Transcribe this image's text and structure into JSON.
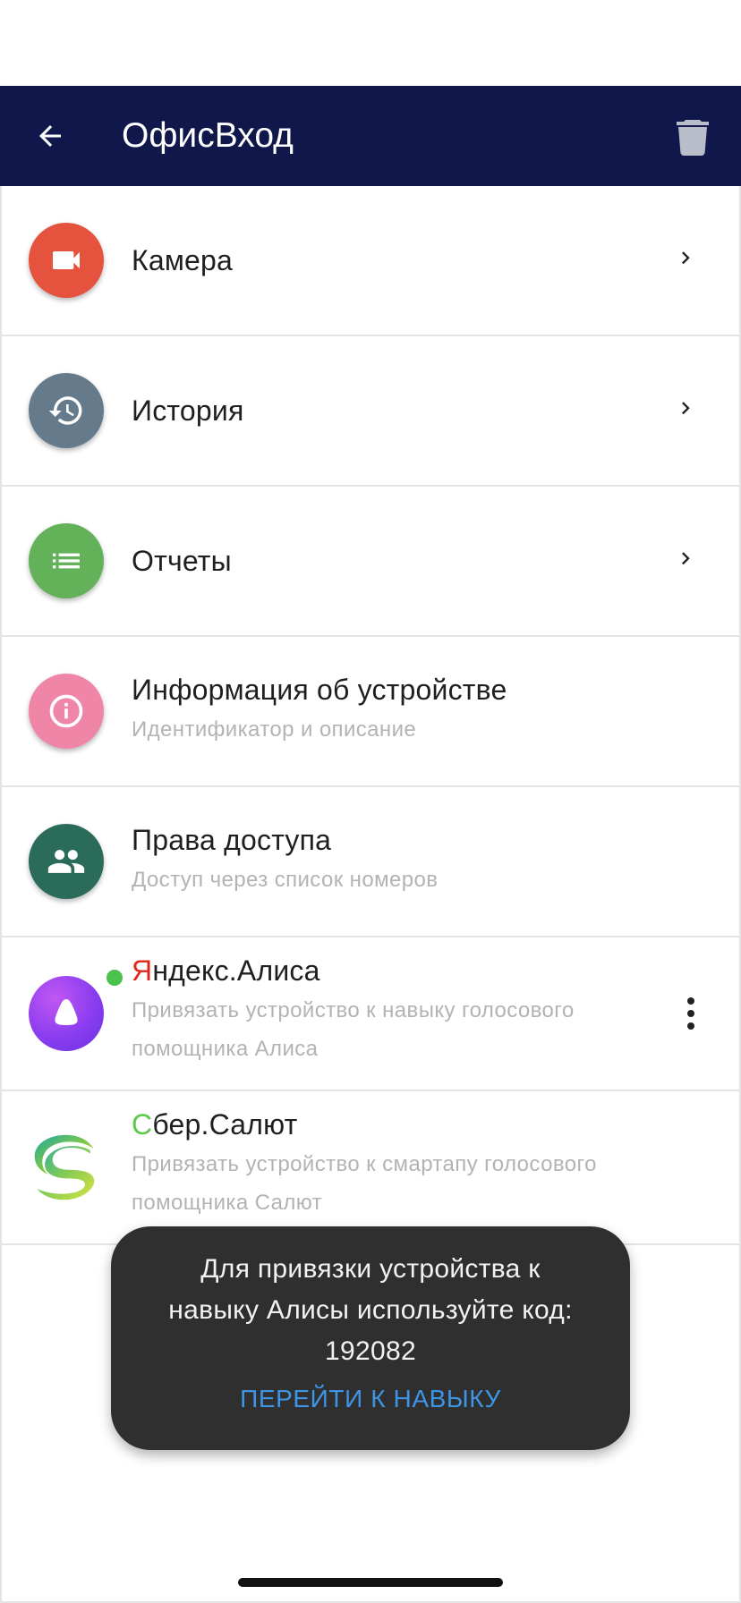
{
  "appbar": {
    "title": "ОфисВход",
    "back_icon": "arrow-back-icon",
    "delete_icon": "trash-icon",
    "background": "#0f174b"
  },
  "items": [
    {
      "title": "Камера",
      "icon": "videocam-icon",
      "color": "#e5533f",
      "has_chevron": true
    },
    {
      "title": "История",
      "icon": "history-icon",
      "color": "#657b8c",
      "has_chevron": true
    },
    {
      "title": "Отчеты",
      "icon": "list-icon",
      "color": "#63b25a",
      "has_chevron": true
    },
    {
      "title": "Информация об устройстве",
      "subtitle": "Идентификатор и описание",
      "icon": "info-icon",
      "color": "#ef86a8"
    },
    {
      "title": "Права доступа",
      "subtitle": "Доступ через список номеров",
      "icon": "people-icon",
      "color": "#2b6b5a"
    },
    {
      "title_first": "Я",
      "title_rest": "ндекс.Алиса",
      "subtitle_line1": "Привязать устройство к навыку голосового",
      "subtitle_line2": "помощника Алиса",
      "icon": "alice-logo-icon",
      "status": "online"
    },
    {
      "title_first": "С",
      "title_rest": "бер.Салют",
      "subtitle_line1": "Привязать устройство к смартапу голосового",
      "subtitle_line2": "помощника Салют",
      "icon": "salute-logo-icon"
    }
  ],
  "toast": {
    "line1": "Для привязки устройства к",
    "line2": "навыку Алисы используйте код:",
    "code": "192082",
    "action": "ПЕРЕЙТИ К НАВЫКУ"
  },
  "colors": {
    "accent_link": "#3e95e6",
    "online": "#4cc150",
    "yandex_red": "#e0261b",
    "sber_green": "#5dc94b"
  }
}
